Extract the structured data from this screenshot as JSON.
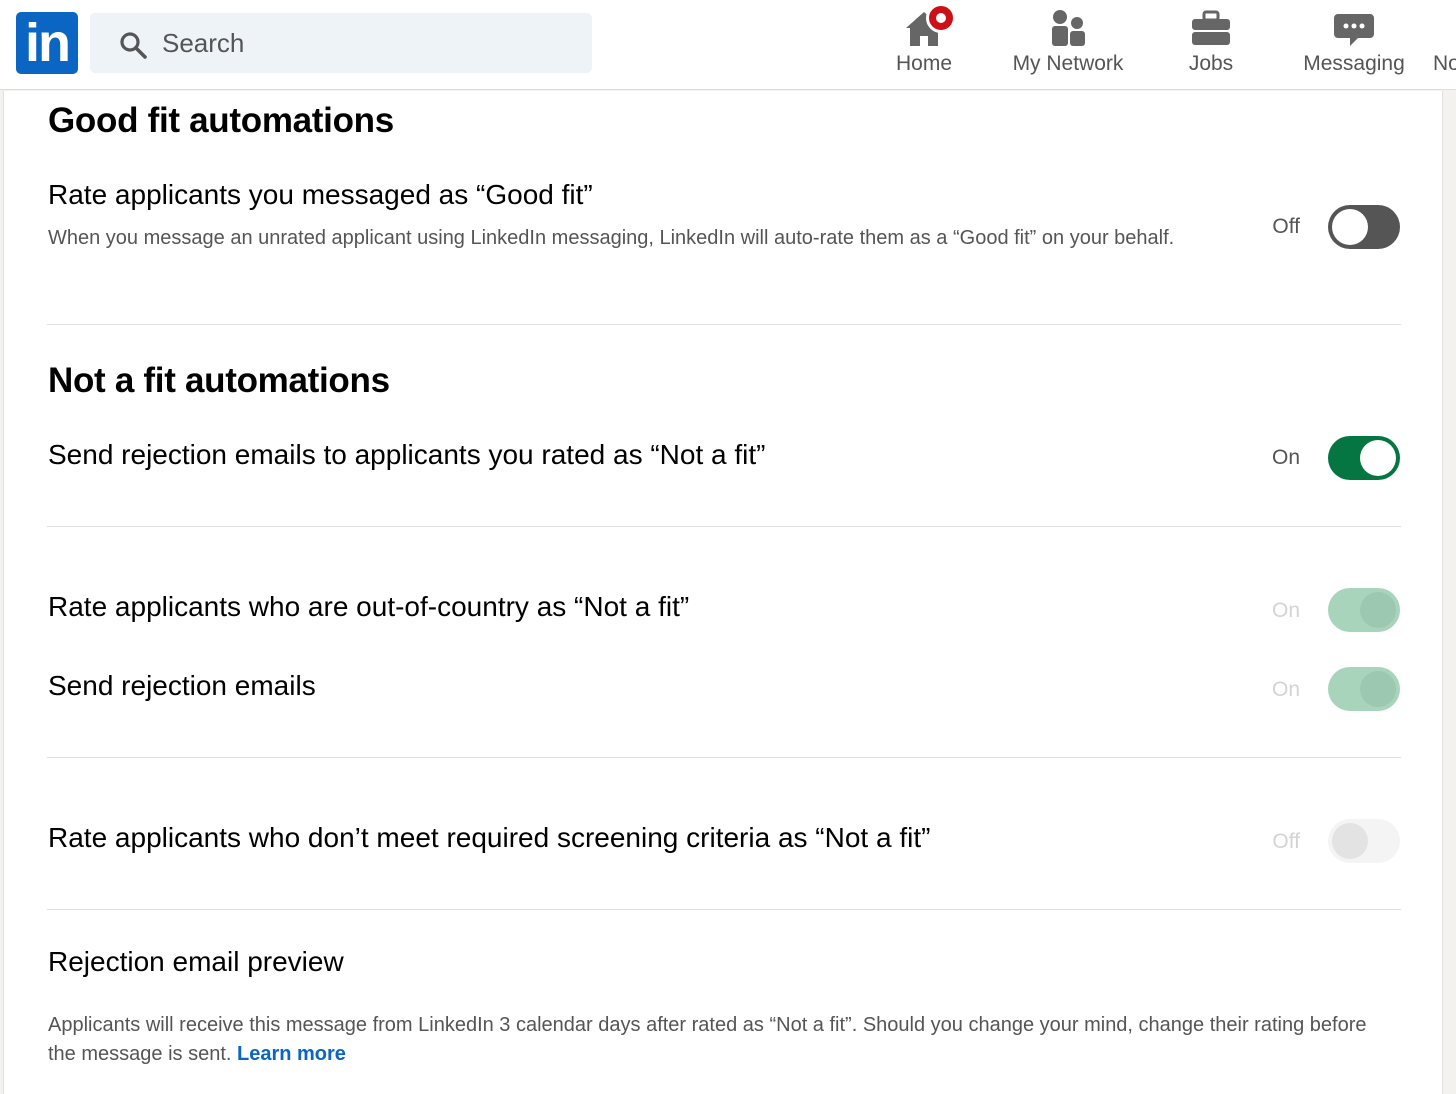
{
  "nav": {
    "logo_text": "in",
    "search_placeholder": "Search",
    "items": [
      {
        "label": "Home",
        "icon": "home-icon",
        "has_notification_badge": true
      },
      {
        "label": "My Network",
        "icon": "network-icon"
      },
      {
        "label": "Jobs",
        "icon": "briefcase-icon"
      },
      {
        "label": "Messaging",
        "icon": "messaging-icon"
      },
      {
        "label": "No",
        "icon": "bell-icon"
      }
    ]
  },
  "good_fit": {
    "section_title": "Good fit automations",
    "row": {
      "title": "Rate applicants you messaged as “Good fit”",
      "description": "When you message an unrated applicant using LinkedIn messaging, LinkedIn will auto-rate them as a “Good fit” on your behalf.",
      "state_label": "Off",
      "enabled": false,
      "disabled": false
    }
  },
  "not_a_fit": {
    "section_title": "Not a fit automations",
    "rows": [
      {
        "title": "Send rejection emails to applicants you rated as “Not a fit”",
        "state_label": "On",
        "enabled": true,
        "disabled": false
      },
      {
        "title": "Rate applicants who are out-of-country as “Not a fit”",
        "state_label": "On",
        "enabled": true,
        "disabled": true
      },
      {
        "title": "Send rejection emails",
        "state_label": "On",
        "enabled": true,
        "disabled": true
      },
      {
        "title": "Rate applicants who don’t meet required screening criteria as “Not a fit”",
        "state_label": "Off",
        "enabled": false,
        "disabled": true
      }
    ]
  },
  "preview": {
    "title": "Rejection email preview",
    "text": "Applicants will receive this message from LinkedIn 3 calendar days after rated as “Not a fit”. Should you change your mind, change their rating before the message is sent.",
    "link_label": "Learn more"
  },
  "colors": {
    "brand": "#0a66c2",
    "toggle_on": "#057642",
    "toggle_off": "#555555",
    "badge": "#cc1016"
  }
}
